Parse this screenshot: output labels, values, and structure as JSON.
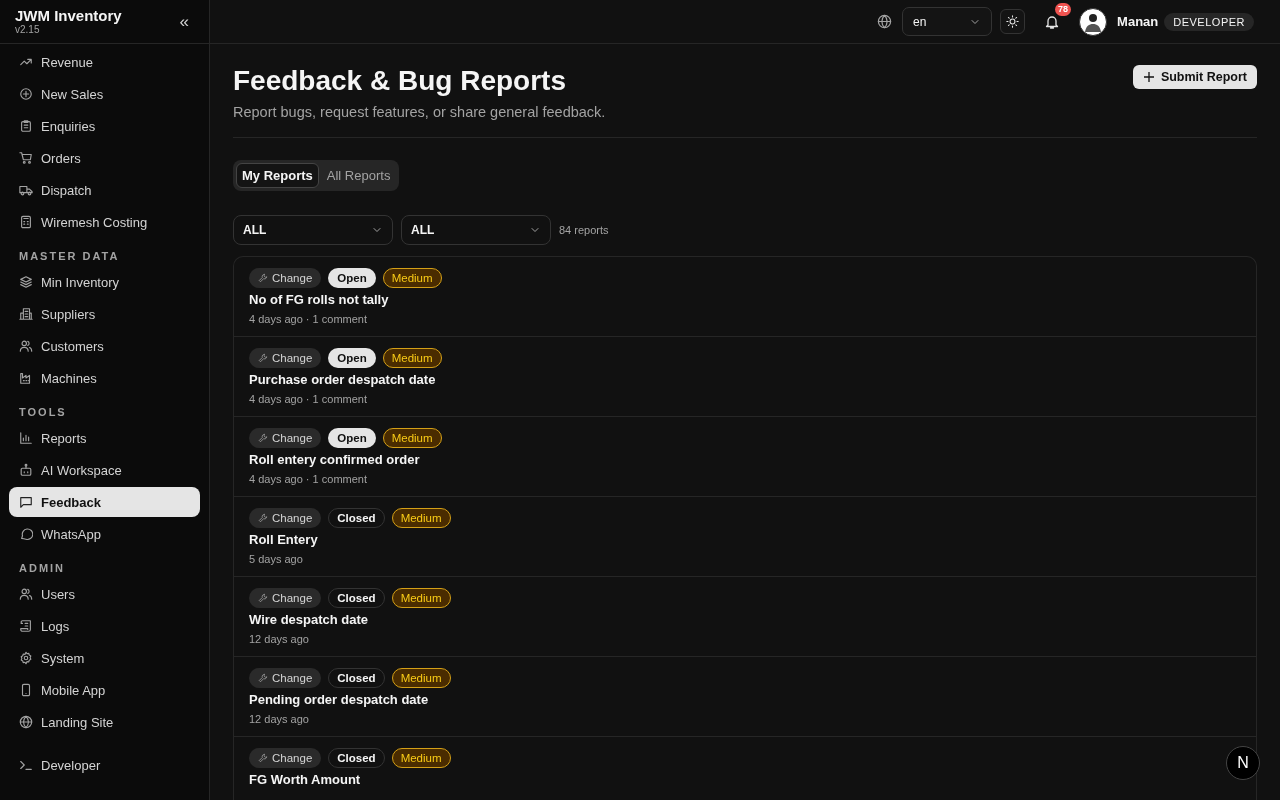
{
  "sidebar": {
    "app_name": "JWM Inventory",
    "version": "v2.15",
    "collapse_label": "«",
    "sections": [
      {
        "items": [
          {
            "label": "Revenue",
            "selected": false
          },
          {
            "label": "New Sales",
            "selected": false
          },
          {
            "label": "Enquiries",
            "selected": false
          },
          {
            "label": "Orders",
            "selected": false
          },
          {
            "label": "Dispatch",
            "selected": false
          },
          {
            "label": "Wiremesh Costing",
            "selected": false
          }
        ]
      },
      {
        "heading": "MASTER DATA",
        "items": [
          {
            "label": "Min Inventory",
            "selected": false
          },
          {
            "label": "Suppliers",
            "selected": false
          },
          {
            "label": "Customers",
            "selected": false
          },
          {
            "label": "Machines",
            "selected": false
          }
        ]
      },
      {
        "heading": "TOOLS",
        "items": [
          {
            "label": "Reports",
            "selected": false
          },
          {
            "label": "AI Workspace",
            "selected": false
          },
          {
            "label": "Feedback",
            "selected": true
          },
          {
            "label": "WhatsApp",
            "selected": false
          }
        ]
      },
      {
        "heading": "ADMIN",
        "items": [
          {
            "label": "Users",
            "selected": false
          },
          {
            "label": "Logs",
            "selected": false
          },
          {
            "label": "System",
            "selected": false
          },
          {
            "label": "Mobile App",
            "selected": false
          },
          {
            "label": "Landing Site",
            "selected": false
          }
        ]
      }
    ],
    "footer_item": {
      "label": "Developer",
      "selected": false
    }
  },
  "header": {
    "language": "en",
    "notifications": "78",
    "user_name": "Manan",
    "role": "DEVELOPER"
  },
  "page": {
    "title": "Feedback & Bug Reports",
    "subtitle": "Report bugs, request features, or share general feedback.",
    "submit_button": "Submit Report"
  },
  "tabs": [
    {
      "label": "My Reports",
      "selected": true
    },
    {
      "label": "All Reports",
      "selected": false
    }
  ],
  "filters": [
    {
      "value": "ALL"
    },
    {
      "value": "ALL"
    }
  ],
  "report_count": "84 reports",
  "reports": [
    {
      "type": "Change",
      "status": {
        "label": "Open",
        "kind": "open"
      },
      "priority": {
        "label": "Medium",
        "kind": "medium"
      },
      "title": "No of FG rolls not tally",
      "meta": "4 days ago · 1 comment"
    },
    {
      "type": "Change",
      "status": {
        "label": "Open",
        "kind": "open"
      },
      "priority": {
        "label": "Medium",
        "kind": "medium"
      },
      "title": "Purchase order despatch date",
      "meta": "4 days ago · 1 comment"
    },
    {
      "type": "Change",
      "status": {
        "label": "Open",
        "kind": "open"
      },
      "priority": {
        "label": "Medium",
        "kind": "medium"
      },
      "title": "Roll entery confirmed order",
      "meta": "4 days ago · 1 comment"
    },
    {
      "type": "Change",
      "status": {
        "label": "Closed",
        "kind": "closed"
      },
      "priority": {
        "label": "Medium",
        "kind": "medium"
      },
      "title": "Roll Entery",
      "meta": "5 days ago"
    },
    {
      "type": "Change",
      "status": {
        "label": "Closed",
        "kind": "closed"
      },
      "priority": {
        "label": "Medium",
        "kind": "medium"
      },
      "title": "Wire despatch date",
      "meta": "12 days ago"
    },
    {
      "type": "Change",
      "status": {
        "label": "Closed",
        "kind": "closed"
      },
      "priority": {
        "label": "Medium",
        "kind": "medium"
      },
      "title": "Pending order despatch date",
      "meta": "12 days ago"
    },
    {
      "type": "Change",
      "status": {
        "label": "Closed",
        "kind": "closed"
      },
      "priority": {
        "label": "Medium",
        "kind": "medium"
      },
      "title": "FG Worth Amount"
    }
  ],
  "dev_badge": "N"
}
